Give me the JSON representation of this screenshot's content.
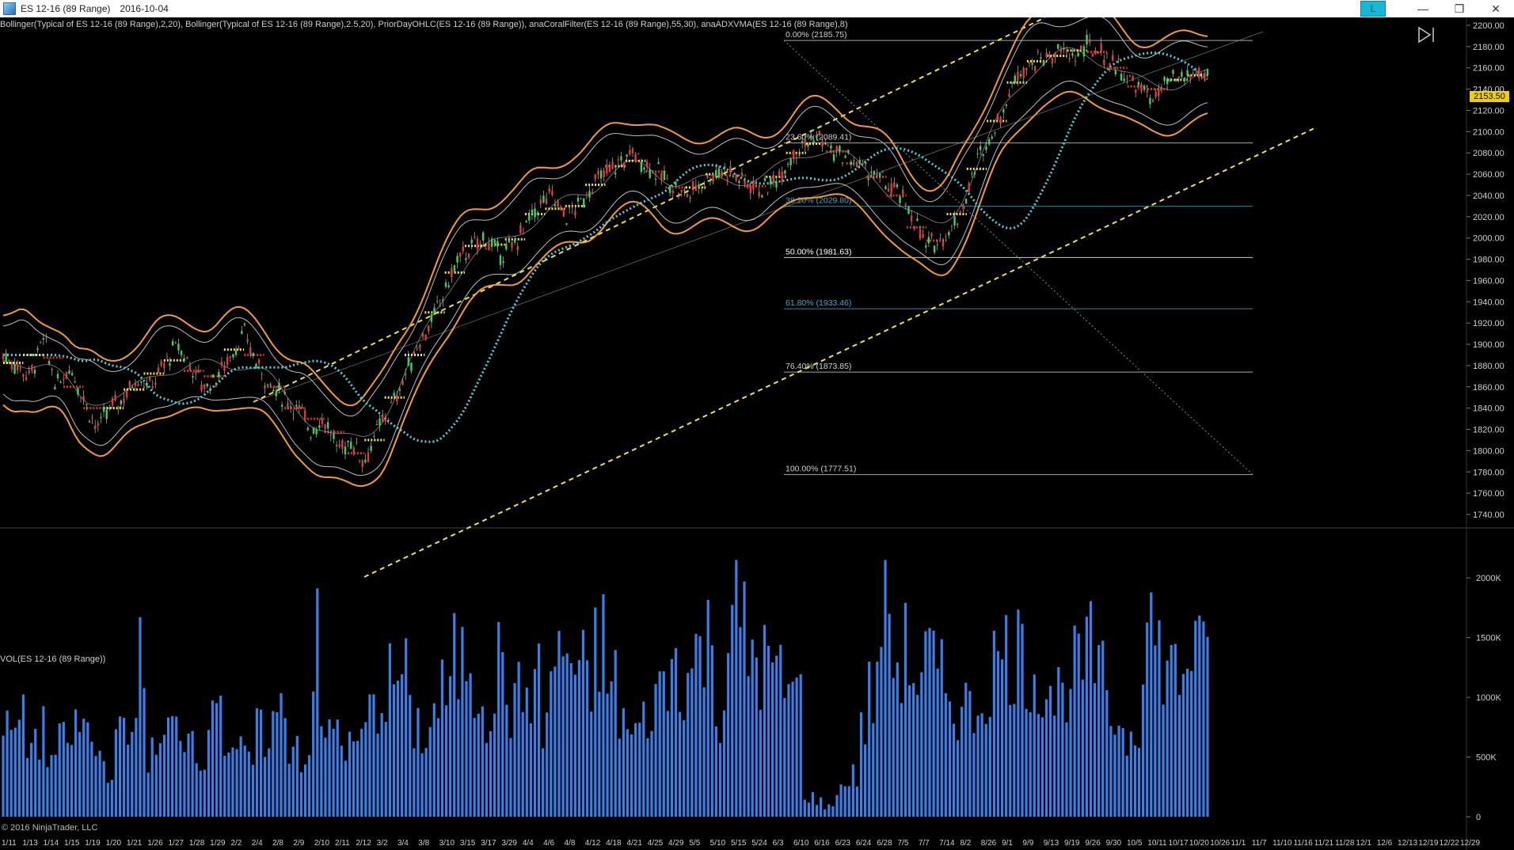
{
  "window": {
    "title": "ES 12-16 (89 Range)",
    "date": "2016-10-04",
    "link_button": "L",
    "minimize": "—",
    "restore": "❐",
    "close": "✕"
  },
  "indicators_label": "Bollinger(Typical of ES 12-16 (89 Range),2,20), Bollinger(Typical of ES 12-16 (89 Range),2.5,20), PriorDayOHLC(ES 12-16 (89 Range)), anaCoralFilter(ES 12-16 (89 Range),55,30), anaADXVMA(ES 12-16 (89 Range),8)",
  "volume_label": "VOL(ES 12-16 (89 Range))",
  "copyright": "© 2016 NinjaTrader, LLC",
  "current_price": "2153.50",
  "icons": {
    "play": "skip-to-end-icon",
    "app": "ninjatrader-icon"
  },
  "colors": {
    "bollinger_outer": "#f39a3a",
    "bollinger_inner": "#bfbfbf",
    "channel": "#f2e24a",
    "coral": "#4fd0e0",
    "adxvma_up": "#f5e64a",
    "adxvma_down": "#d83a2a",
    "volume": "#3a7ee8",
    "price_tag": "#f0d000"
  },
  "price_axis": {
    "ticks": [
      "2200.00",
      "2180.00",
      "2160.00",
      "2140.00",
      "2120.00",
      "2100.00",
      "2080.00",
      "2060.00",
      "2040.00",
      "2020.00",
      "2000.00",
      "1980.00",
      "1960.00",
      "1940.00",
      "1920.00",
      "1900.00",
      "1880.00",
      "1860.00",
      "1840.00",
      "1820.00",
      "1800.00",
      "1780.00",
      "1760.00",
      "1740.00"
    ],
    "min": 1740,
    "max": 2200
  },
  "volume_axis": {
    "ticks": [
      "2000K",
      "1500K",
      "1000K",
      "500K",
      "0"
    ]
  },
  "fib_levels": [
    {
      "label": "0.00% (2185.75)",
      "value": 2185.75,
      "color": "#d0d0d0"
    },
    {
      "label": "23.60% (2089.41)",
      "value": 2089.41,
      "color": "#d0d0d0"
    },
    {
      "label": "38.20% (2029.80)",
      "value": 2029.8,
      "color": "#3aa8d0"
    },
    {
      "label": "50.00% (1981.63)",
      "value": 1981.63,
      "color": "#ffffff"
    },
    {
      "label": "61.80% (1933.46)",
      "value": 1933.46,
      "color": "#3aa8d0"
    },
    {
      "label": "76.40% (1873.85)",
      "value": 1873.85,
      "color": "#d0d0d0"
    },
    {
      "label": "100.00% (1777.51)",
      "value": 1777.51,
      "color": "#d0d0d0"
    }
  ],
  "date_axis": [
    "1/11",
    "1/13",
    "1/14",
    "1/15",
    "1/19",
    "1/20",
    "1/21",
    "1/26",
    "1/27",
    "1/28",
    "1/29",
    "2/2",
    "2/4",
    "2/8",
    "2/9",
    "2/10",
    "2/11",
    "2/12",
    "3/2",
    "3/4",
    "3/8",
    "3/10",
    "3/15",
    "3/17",
    "3/29",
    "4/4",
    "4/6",
    "4/8",
    "4/12",
    "4/18",
    "4/21",
    "4/25",
    "4/29",
    "5/5",
    "5/10",
    "5/15",
    "5/24",
    "6/3",
    "6/10",
    "6/16",
    "6/23",
    "6/24",
    "6/28",
    "7/5",
    "7/7",
    "7/14",
    "8/2",
    "8/26",
    "9/1",
    "9/9",
    "9/13",
    "9/19",
    "9/26",
    "9/30",
    "10/5",
    "10/11",
    "10/17",
    "10/20",
    "10/26",
    "11/1",
    "11/7",
    "11/10",
    "11/16",
    "11/21",
    "11/28",
    "12/1",
    "12/6",
    "12/13",
    "12/19",
    "12/22",
    "12/29"
  ],
  "chart_data": {
    "type": "candlestick-with-volume",
    "title": "ES 12-16 (89 Range)",
    "ylim": [
      1740,
      2200
    ],
    "close_path": [
      1890,
      1880,
      1870,
      1905,
      1860,
      1880,
      1850,
      1820,
      1840,
      1850,
      1870,
      1860,
      1880,
      1900,
      1880,
      1860,
      1870,
      1890,
      1910,
      1880,
      1860,
      1850,
      1840,
      1820,
      1830,
      1800,
      1810,
      1790,
      1820,
      1840,
      1870,
      1900,
      1920,
      1950,
      1980,
      1990,
      2000,
      1985,
      1990,
      2010,
      2030,
      2040,
      2020,
      2030,
      2050,
      2060,
      2070,
      2080,
      2070,
      2060,
      2050,
      2040,
      2050,
      2060,
      2065,
      2055,
      2050,
      2045,
      2060,
      2080,
      2090,
      2095,
      2080,
      2075,
      2070,
      2060,
      2050,
      2040,
      2020,
      1990,
      2000,
      2010,
      2040,
      2080,
      2100,
      2130,
      2160,
      2165,
      2170,
      2175,
      2170,
      2180,
      2175,
      2165,
      2150,
      2140,
      2130,
      2145,
      2150,
      2155,
      2153.5
    ],
    "volume_k": [
      800,
      900,
      750,
      820,
      600,
      700,
      850,
      900,
      650,
      500,
      750,
      800,
      1500,
      600,
      700,
      850,
      900,
      800,
      650,
      1400,
      700,
      600,
      550,
      800,
      900,
      1000,
      750,
      600,
      1700,
      800,
      900,
      650,
      700,
      1000,
      1200,
      1300,
      1400,
      900,
      800,
      1100,
      1200,
      1500,
      1600,
      1300,
      1100,
      1500,
      1000,
      1200,
      1300,
      900,
      1500,
      1600,
      1400,
      1200,
      1700,
      1300,
      1000,
      800,
      900,
      1200,
      1300,
      1500,
      1400,
      1600,
      1700,
      1100,
      2000,
      1800,
      1600,
      1500,
      1400,
      1300,
      1200,
      200,
      150,
      100,
      300,
      400,
      900,
      1200,
      2200,
      1500,
      1600,
      1400,
      1500,
      1300,
      1200,
      1100,
      1000,
      1200,
      1500,
      1600,
      1700,
      1500,
      1400,
      1300,
      1200,
      1400,
      1500,
      1600,
      1300,
      1000,
      800,
      900,
      2000,
      1600,
      1500,
      1400,
      1700,
      1500,
      1600
    ]
  }
}
